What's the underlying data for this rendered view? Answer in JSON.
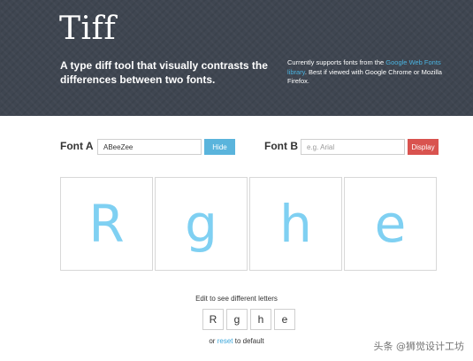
{
  "header": {
    "title": "Tiff",
    "tagline": "A type diff tool that visually contrasts the differences between two fonts.",
    "support_prefix": "Currently supports fonts from the ",
    "support_link": "Google Web Fonts library",
    "support_suffix": ". Best if viewed with Google Chrome or Mozilla Firefox."
  },
  "font_a": {
    "label": "Font A",
    "value": "ABeeZee",
    "placeholder": "",
    "button_label": "Hide"
  },
  "font_b": {
    "label": "Font B",
    "value": "",
    "placeholder": "e.g. Arial",
    "button_label": "Display"
  },
  "letters": [
    "R",
    "g",
    "h",
    "e"
  ],
  "edit": {
    "hint": "Edit to see different letters",
    "letters": [
      "R",
      "g",
      "h",
      "e"
    ],
    "reset_prefix": "or ",
    "reset_link": "reset",
    "reset_suffix": " to default"
  },
  "watermark": "头条 @狮觉设计工坊",
  "colors": {
    "header_bg": "#3f4651",
    "link": "#4ab3e0",
    "hide_button": "#5ab4dc",
    "display_button": "#d9534f",
    "glyph": "#7fd0f2"
  }
}
